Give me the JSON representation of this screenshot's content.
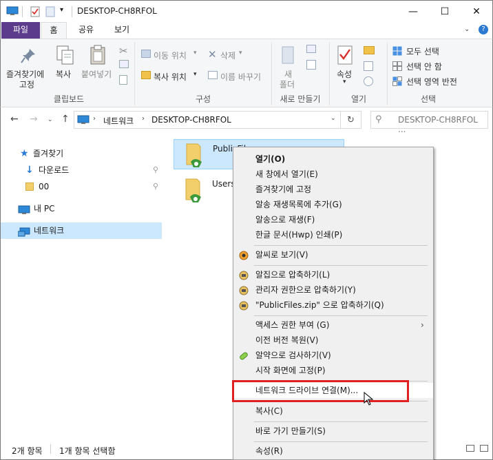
{
  "window": {
    "title": "DESKTOP-CH8RFOL",
    "minimize_glyph": "—",
    "maximize_glyph": "☐",
    "close_glyph": "✕"
  },
  "ribbon_tabs": [
    "파일",
    "홈",
    "공유",
    "보기"
  ],
  "ribbon": {
    "clipboard": {
      "pin_label_1": "즐겨찾기에",
      "pin_label_2": "고정",
      "copy": "복사",
      "paste": "붙여넣기",
      "group": "클립보드"
    },
    "organize": {
      "move_to": "이동 위치",
      "copy_to": "복사 위치",
      "delete": "삭제",
      "rename": "이름 바꾸기",
      "group": "구성"
    },
    "new": {
      "new_folder_1": "새",
      "new_folder_2": "폴더",
      "group": "새로 만들기"
    },
    "open": {
      "properties": "속성",
      "group": "열기"
    },
    "select": {
      "select_all": "모두 선택",
      "select_none": "선택 안 함",
      "invert": "선택 영역 반전",
      "group": "선택"
    }
  },
  "address": {
    "path": [
      "네트워크",
      "DESKTOP-CH8RFOL"
    ],
    "search_placeholder": "DESKTOP-CH8RFOL ..."
  },
  "nav": {
    "quick_access": "즐겨찾기",
    "downloads": "다운로드",
    "folder_00": "00",
    "this_pc": "내 PC",
    "network": "네트워크"
  },
  "files": [
    {
      "name": "PublicFiles"
    },
    {
      "name": "Users"
    }
  ],
  "context_menu": [
    {
      "label": "열기(O)",
      "bold": true
    },
    {
      "label": "새 창에서 열기(E)"
    },
    {
      "label": "즐겨찾기에 고정"
    },
    {
      "label": "알송 재생목록에 추가(G)"
    },
    {
      "label": "알송으로 재생(F)"
    },
    {
      "label": "한글 문서(Hwp) 인쇄(P)"
    },
    {
      "label": "알씨로 보기(V)"
    },
    {
      "label": "알집으로 압축하기(L)"
    },
    {
      "label": "관리자 권한으로 압축하기(Y)"
    },
    {
      "label": "\"PublicFiles.zip\" 으로 압축하기(Q)"
    },
    {
      "label": "액세스 권한 부여 (G)"
    },
    {
      "label": "이전 버전 복원(V)"
    },
    {
      "label": "알약으로 검사하기(V)"
    },
    {
      "label": "시작 화면에 고정(P)"
    },
    {
      "label": "네트워크 드라이브 연결(M)..."
    },
    {
      "label": "복사(C)"
    },
    {
      "label": "바로 가기 만들기(S)"
    },
    {
      "label": "속성(R)"
    }
  ],
  "status": {
    "count": "2개 항목",
    "selected": "1개 항목 선택함"
  },
  "colors": {
    "file_tab": "#5d3b8c",
    "selection": "#cce8ff",
    "highlight_box": "#e02020"
  }
}
